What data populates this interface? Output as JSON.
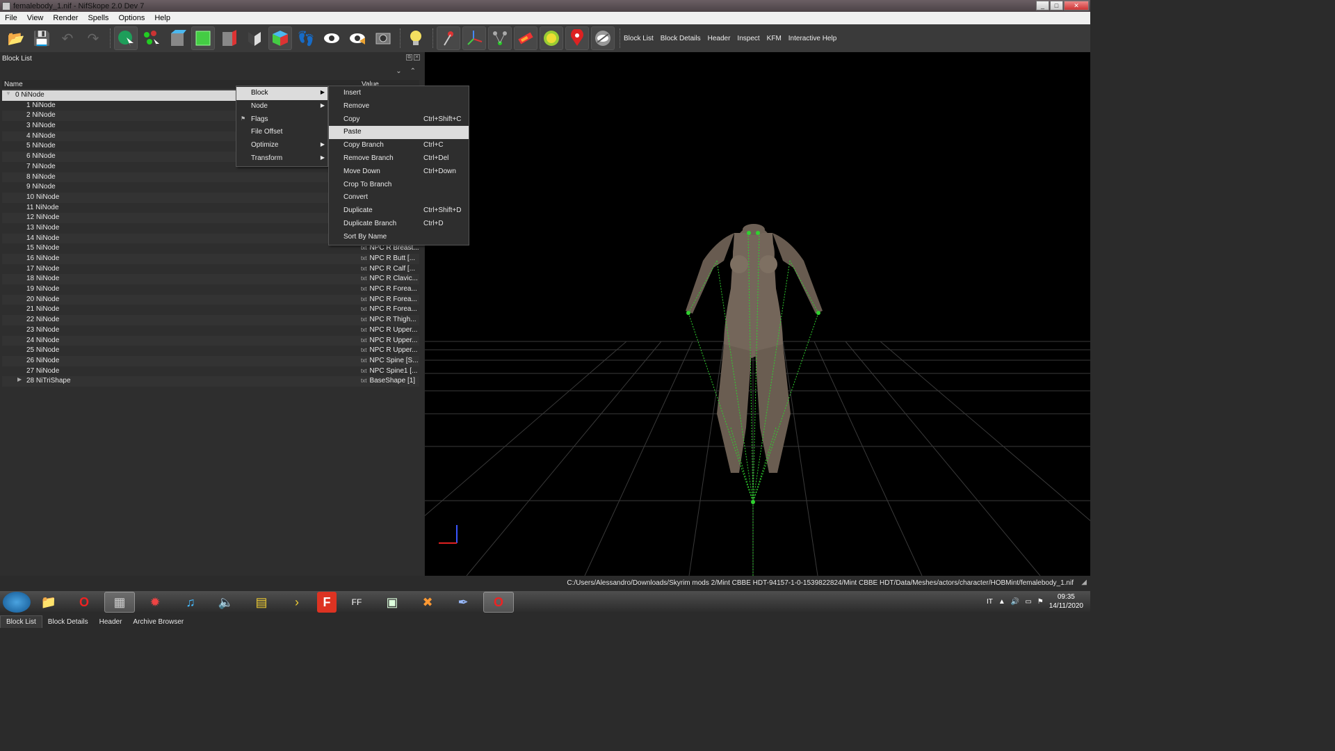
{
  "window": {
    "title": "femalebody_1.nif - NifSkope 2.0 Dev 7",
    "controls": [
      "_",
      "□",
      "✕"
    ]
  },
  "menubar": [
    "File",
    "View",
    "Render",
    "Spells",
    "Options",
    "Help"
  ],
  "toolbar": {
    "icons": [
      "open-file-icon",
      "save-icon",
      "undo-icon",
      "redo-icon",
      "select-object-icon",
      "select-vertex-icon",
      "view-top-icon",
      "view-front-icon",
      "view-side-icon",
      "view-flip-icon",
      "view-user-icon",
      "walk-icon",
      "visibility-icon",
      "hidden-visibility-icon",
      "screenshot-icon",
      "lighting-icon",
      "pin-icon",
      "axes-icon",
      "nodes-icon",
      "material-icon",
      "textures-icon",
      "marker-icon",
      "hide-icon"
    ],
    "text_buttons": [
      "Block List",
      "Block Details",
      "Header",
      "Inspect",
      "KFM",
      "Interactive Help"
    ]
  },
  "block_list": {
    "title": "Block List",
    "columns": [
      "Name",
      "Value"
    ],
    "rows": [
      {
        "name": "0 NiNode",
        "value": ""
      },
      {
        "name": "1 NiNode",
        "value": ""
      },
      {
        "name": "2 NiNode",
        "value": ""
      },
      {
        "name": "3 NiNode",
        "value": ""
      },
      {
        "name": "4 NiNode",
        "value": ""
      },
      {
        "name": "5 NiNode",
        "value": ""
      },
      {
        "name": "6 NiNode",
        "value": ""
      },
      {
        "name": "7 NiNode",
        "value": ""
      },
      {
        "name": "8 NiNode",
        "value": ""
      },
      {
        "name": "9 NiNode",
        "value": ""
      },
      {
        "name": "10 NiNode",
        "value": ""
      },
      {
        "name": "11 NiNode",
        "value": ""
      },
      {
        "name": "12 NiNode",
        "value": ""
      },
      {
        "name": "13 NiNode",
        "value": ""
      },
      {
        "name": "14 NiNode",
        "value": ""
      },
      {
        "name": "15 NiNode",
        "value": "NPC R Breast..."
      },
      {
        "name": "16 NiNode",
        "value": "NPC R Butt [..."
      },
      {
        "name": "17 NiNode",
        "value": "NPC R Calf [..."
      },
      {
        "name": "18 NiNode",
        "value": "NPC R Clavic..."
      },
      {
        "name": "19 NiNode",
        "value": "NPC R Forea..."
      },
      {
        "name": "20 NiNode",
        "value": "NPC R Forea..."
      },
      {
        "name": "21 NiNode",
        "value": "NPC R Forea..."
      },
      {
        "name": "22 NiNode",
        "value": "NPC R Thigh..."
      },
      {
        "name": "23 NiNode",
        "value": "NPC R Upper..."
      },
      {
        "name": "24 NiNode",
        "value": "NPC R Upper..."
      },
      {
        "name": "25 NiNode",
        "value": "NPC R Upper..."
      },
      {
        "name": "26 NiNode",
        "value": "NPC Spine [S..."
      },
      {
        "name": "27 NiNode",
        "value": "NPC Spine1 [..."
      },
      {
        "name": "28 NiTriShape",
        "value": "BaseShape [1]"
      }
    ],
    "value_icon": "txt"
  },
  "context_menu": {
    "items": [
      {
        "label": "Block",
        "submenu": true
      },
      {
        "label": "Node",
        "submenu": true
      },
      {
        "label": "Flags",
        "submenu": false
      },
      {
        "label": "File Offset",
        "submenu": false
      },
      {
        "label": "Optimize",
        "submenu": true
      },
      {
        "label": "Transform",
        "submenu": true
      }
    ],
    "highlighted": "Block"
  },
  "block_submenu": {
    "items": [
      {
        "label": "Insert",
        "shortcut": ""
      },
      {
        "label": "Remove",
        "shortcut": ""
      },
      {
        "label": "Copy",
        "shortcut": "Ctrl+Shift+C"
      },
      {
        "label": "Paste",
        "shortcut": ""
      },
      {
        "label": "Copy Branch",
        "shortcut": "Ctrl+C"
      },
      {
        "label": "Remove Branch",
        "shortcut": "Ctrl+Del"
      },
      {
        "label": "Move Down",
        "shortcut": "Ctrl+Down"
      },
      {
        "label": "Crop To Branch",
        "shortcut": ""
      },
      {
        "label": "Convert",
        "shortcut": ""
      },
      {
        "label": "Duplicate",
        "shortcut": "Ctrl+Shift+D"
      },
      {
        "label": "Duplicate Branch",
        "shortcut": "Ctrl+D"
      },
      {
        "label": "Sort By Name",
        "shortcut": ""
      }
    ],
    "highlighted": "Paste"
  },
  "bottom_tabs": [
    "Block List",
    "Block Details",
    "Header",
    "Archive Browser"
  ],
  "status": {
    "path": "C:/Users/Alessandro/Downloads/Skyrim mods 2/Mint CBBE HDT-94157-1-0-1539822824/Mint CBBE HDT/Data/Meshes/actors/character/HOBMint/femalebody_1.nif"
  },
  "taskbar": {
    "apps": [
      "explorer-icon",
      "opera-icon",
      "media-icon",
      "game-icon",
      "music-icon",
      "audio-icon",
      "editor-icon",
      "tool-icon",
      "f-app-icon",
      "ff-app-icon",
      "window-app-icon",
      "x-app-icon",
      "feather-icon",
      "opera-active-icon"
    ],
    "lang": "IT",
    "time": "09:35",
    "date": "14/11/2020"
  },
  "colors": {
    "accent_green": "#2fd12f",
    "viewport_bg": "#000000",
    "panel_bg": "#2e2e2e"
  }
}
